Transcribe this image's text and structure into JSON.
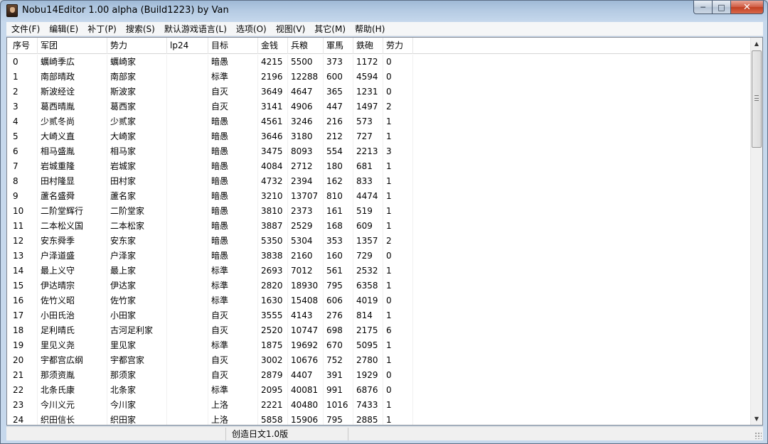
{
  "window": {
    "title": "Nobu14Editor 1.00 alpha (Build1223) by Van"
  },
  "menu": [
    "文件(F)",
    "编辑(E)",
    "补丁(P)",
    "搜索(S)",
    "默认游戏语言(L)",
    "选项(O)",
    "视图(V)",
    "其它(M)",
    "帮助(H)"
  ],
  "table": {
    "columns": [
      "序号",
      "军团",
      "势力",
      "lp24",
      "目标",
      "金钱",
      "兵粮",
      "軍馬",
      "鉄砲",
      "劳力"
    ],
    "rows": [
      [
        "0",
        "蠣崎季広",
        "蠣崎家",
        "",
        "暗愚",
        "4215",
        "5500",
        "373",
        "1172",
        "0"
      ],
      [
        "1",
        "南部晴政",
        "南部家",
        "",
        "标準",
        "2196",
        "12288",
        "600",
        "4594",
        "0"
      ],
      [
        "2",
        "斯波经诠",
        "斯波家",
        "",
        "自灭",
        "3649",
        "4647",
        "365",
        "1231",
        "0"
      ],
      [
        "3",
        "葛西晴胤",
        "葛西家",
        "",
        "自灭",
        "3141",
        "4906",
        "447",
        "1497",
        "2"
      ],
      [
        "4",
        "少贰冬尚",
        "少贰家",
        "",
        "暗愚",
        "4561",
        "3246",
        "216",
        "573",
        "1"
      ],
      [
        "5",
        "大崎义直",
        "大崎家",
        "",
        "暗愚",
        "3646",
        "3180",
        "212",
        "727",
        "1"
      ],
      [
        "6",
        "相马盛胤",
        "相马家",
        "",
        "暗愚",
        "3475",
        "8093",
        "554",
        "2213",
        "3"
      ],
      [
        "7",
        "岩城重隆",
        "岩城家",
        "",
        "暗愚",
        "4084",
        "2712",
        "180",
        "681",
        "1"
      ],
      [
        "8",
        "田村隆显",
        "田村家",
        "",
        "暗愚",
        "4732",
        "2394",
        "162",
        "833",
        "1"
      ],
      [
        "9",
        "蘆名盛舜",
        "蘆名家",
        "",
        "暗愚",
        "3210",
        "13707",
        "810",
        "4474",
        "1"
      ],
      [
        "10",
        "二阶堂辉行",
        "二阶堂家",
        "",
        "暗愚",
        "3810",
        "2373",
        "161",
        "519",
        "1"
      ],
      [
        "11",
        "二本松义国",
        "二本松家",
        "",
        "暗愚",
        "3887",
        "2529",
        "168",
        "609",
        "1"
      ],
      [
        "12",
        "安东舜季",
        "安东家",
        "",
        "暗愚",
        "5350",
        "5304",
        "353",
        "1357",
        "2"
      ],
      [
        "13",
        "户泽道盛",
        "户泽家",
        "",
        "暗愚",
        "3838",
        "2160",
        "160",
        "729",
        "0"
      ],
      [
        "14",
        "最上义守",
        "最上家",
        "",
        "标準",
        "2693",
        "7012",
        "561",
        "2532",
        "1"
      ],
      [
        "15",
        "伊达晴宗",
        "伊达家",
        "",
        "标準",
        "2820",
        "18930",
        "795",
        "6358",
        "1"
      ],
      [
        "16",
        "佐竹义昭",
        "佐竹家",
        "",
        "标準",
        "1630",
        "15408",
        "606",
        "4019",
        "0"
      ],
      [
        "17",
        "小田氏治",
        "小田家",
        "",
        "自灭",
        "3555",
        "4143",
        "276",
        "814",
        "1"
      ],
      [
        "18",
        "足利晴氏",
        "古河足利家",
        "",
        "自灭",
        "2520",
        "10747",
        "698",
        "2175",
        "6"
      ],
      [
        "19",
        "里见义尧",
        "里见家",
        "",
        "标準",
        "1875",
        "19692",
        "670",
        "5095",
        "1"
      ],
      [
        "20",
        "宇都宫広纲",
        "宇都宫家",
        "",
        "自灭",
        "3002",
        "10676",
        "752",
        "2780",
        "1"
      ],
      [
        "21",
        "那须资胤",
        "那须家",
        "",
        "自灭",
        "2879",
        "4407",
        "391",
        "1929",
        "0"
      ],
      [
        "22",
        "北条氏康",
        "北条家",
        "",
        "标準",
        "2095",
        "40081",
        "991",
        "6876",
        "0"
      ],
      [
        "23",
        "今川义元",
        "今川家",
        "",
        "上洛",
        "2221",
        "40480",
        "1016",
        "7433",
        "1"
      ],
      [
        "24",
        "织田信长",
        "织田家",
        "",
        "上洛",
        "5858",
        "15906",
        "795",
        "2885",
        "1"
      ]
    ]
  },
  "statusbar": {
    "pane1": "",
    "pane2": "创造日文1.0版"
  }
}
